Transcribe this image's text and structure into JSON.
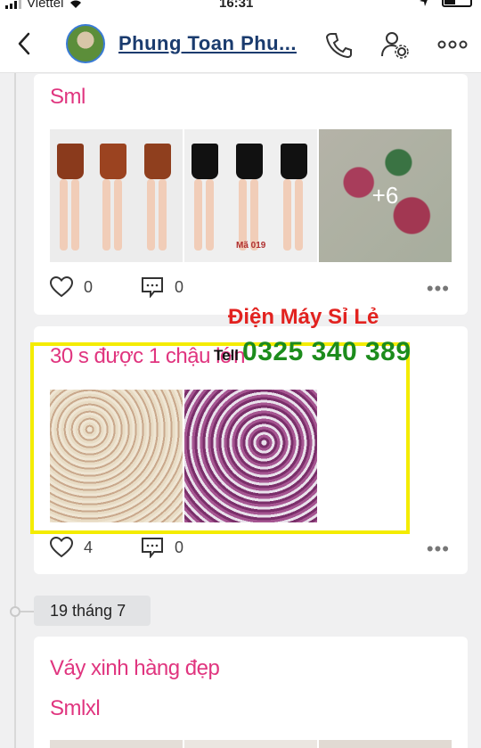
{
  "status_bar": {
    "carrier": "Viettel",
    "time": "16:31"
  },
  "header": {
    "title": "Phung Toan Phu..."
  },
  "posts": [
    {
      "title": "Sml",
      "image_more_label": "+6",
      "image_code": "Mã 019",
      "likes": "0",
      "comments": "0"
    },
    {
      "title": "30 s được 1 chậu lớn",
      "likes": "4",
      "comments": "0"
    }
  ],
  "watermark": {
    "line1": "Điện Máy Sỉ Lẻ",
    "tell_label": "Tell",
    "phone": "0325 340 389"
  },
  "date_separator": "19 tháng 7",
  "post3": {
    "title": "Váy xinh hàng đẹp",
    "subtitle": "Smlxl"
  }
}
